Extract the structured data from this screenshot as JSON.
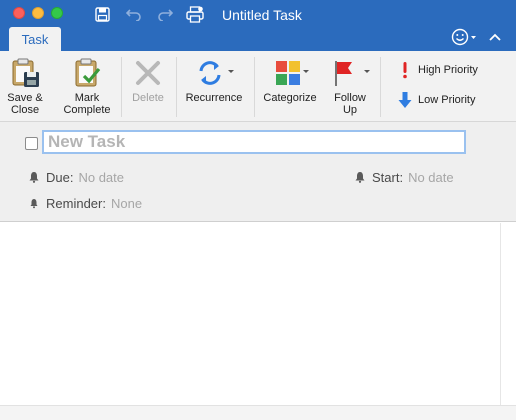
{
  "window": {
    "title": "Untitled Task",
    "accent": "#2b6bbd"
  },
  "titlebar": {
    "icons": [
      "save-icon",
      "undo-icon",
      "redo-icon",
      "print-icon"
    ]
  },
  "tabs": [
    {
      "label": "Task",
      "active": true
    }
  ],
  "ribbon": {
    "save_close_label": "Save &\nClose",
    "mark_complete_label": "Mark\nComplete",
    "delete_label": "Delete",
    "recurrence_label": "Recurrence",
    "categorize_label": "Categorize",
    "follow_up_label": "Follow\nUp",
    "high_priority_label": "High Priority",
    "low_priority_label": "Low Priority"
  },
  "form": {
    "subject_placeholder": "New Task",
    "subject_value": "",
    "due_label": "Due:",
    "due_value": "No date",
    "start_label": "Start:",
    "start_value": "No date",
    "reminder_label": "Reminder:",
    "reminder_value": "None"
  },
  "colors": {
    "high_priority": "#e02424",
    "low_priority": "#2f7de1",
    "follow_up_flag": "#e02424",
    "mark_complete": "#3a9a3a"
  }
}
